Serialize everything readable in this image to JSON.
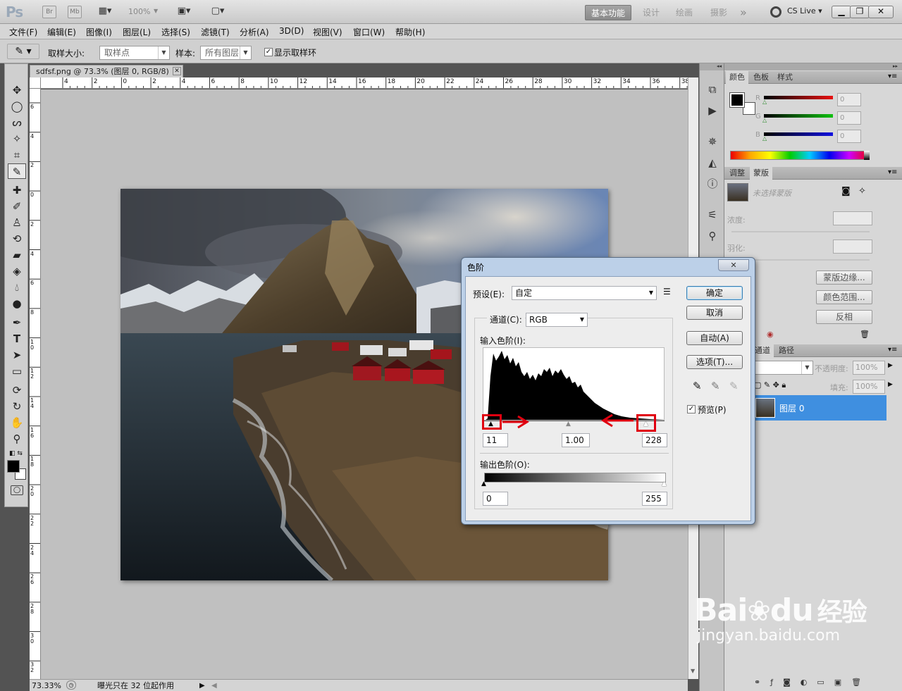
{
  "app": {
    "logo": "Ps",
    "bridge": "Br",
    "minibridge": "Mb",
    "zoom": "100%",
    "workspaces": [
      "基本功能",
      "设计",
      "绘画",
      "摄影"
    ],
    "more": "»",
    "cslive": "CS Live"
  },
  "menu": [
    "文件(F)",
    "编辑(E)",
    "图像(I)",
    "图层(L)",
    "选择(S)",
    "滤镜(T)",
    "分析(A)",
    "3D(D)",
    "视图(V)",
    "窗口(W)",
    "帮助(H)"
  ],
  "options": {
    "sample_size_label": "取样大小:",
    "sample_size_value": "取样点",
    "sample_label": "样本:",
    "sample_value": "所有图层",
    "show_ring_label": "显示取样环"
  },
  "document": {
    "tab_title": "sdfsf.png @ 73.3% (图层 0, RGB/8)",
    "hruler_ticks": [
      "4",
      "2",
      "0",
      "2",
      "4",
      "6",
      "8",
      "10",
      "12",
      "14",
      "16",
      "18",
      "20",
      "22",
      "24",
      "26",
      "28",
      "30",
      "32",
      "34",
      "36",
      "38"
    ],
    "vruler_ticks": [
      "6",
      "4",
      "2",
      "0",
      "2",
      "4",
      "6",
      "8",
      "1 0",
      "1 2",
      "1 4",
      "1 6",
      "1 8",
      "2 0",
      "2 2",
      "2 4",
      "2 6",
      "2 8",
      "3 0",
      "3 2"
    ]
  },
  "status": {
    "zoom": "73.33%",
    "info": "曝光只在 32 位起作用"
  },
  "color_panel": {
    "tabs": [
      "颜色",
      "色板",
      "样式"
    ],
    "channels": [
      {
        "label": "R",
        "value": "0",
        "color": "#e81010"
      },
      {
        "label": "G",
        "value": "0",
        "color": "#10c010"
      },
      {
        "label": "B",
        "value": "0",
        "color": "#1010e0"
      }
    ]
  },
  "adjust_panel": {
    "tabs": [
      "调整",
      "蒙版"
    ],
    "no_mask": "未选择蒙版",
    "density_label": "浓度:",
    "feather_label": "羽化:",
    "btn_mask_edge": "蒙版边缘...",
    "btn_color_range": "颜色范围...",
    "btn_invert": "反相"
  },
  "layers_panel": {
    "tabs": [
      "通道",
      "路径"
    ],
    "opacity_label": "不透明度:",
    "opacity_value": "100%",
    "fill_label": "填充:",
    "fill_value": "100%",
    "layer_name": "图层 0"
  },
  "levels_dialog": {
    "title": "色阶",
    "close": "✕",
    "preset_label": "预设(E):",
    "preset_value": "自定",
    "channel_label": "通道(C):",
    "channel_value": "RGB",
    "input_label": "输入色阶(I):",
    "input_black": "11",
    "input_gamma": "1.00",
    "input_white": "228",
    "output_label": "输出色阶(O):",
    "output_black": "0",
    "output_white": "255",
    "btn_ok": "确定",
    "btn_cancel": "取消",
    "btn_auto": "自动(A)",
    "btn_options": "选项(T)...",
    "preview_label": "预览(P)"
  },
  "watermark": {
    "brand": "Bai",
    "brand2": "du",
    "brand_cn": "经验",
    "url": "jingyan.baidu.com"
  }
}
